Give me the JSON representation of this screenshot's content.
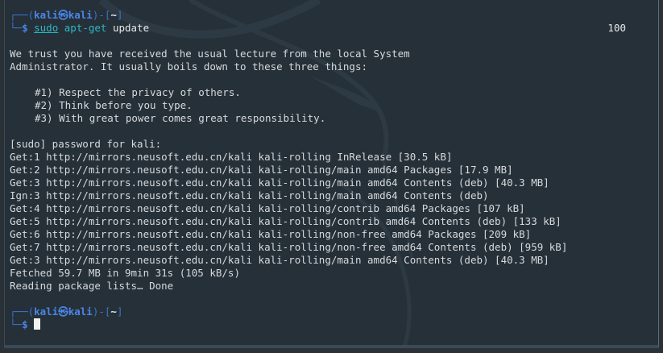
{
  "prompt": {
    "user": "kali",
    "at_icon": "kali-skull-icon",
    "host": "kali",
    "dir": "~",
    "top_left": "┌──(",
    "mid": ")-[",
    "top_right": "]",
    "bottom_left": "└─",
    "dollar": "$"
  },
  "command": {
    "sudo": "sudo",
    "aptget": "apt-get",
    "arg": "update",
    "exit_status": "100",
    "exit_icon": "✗"
  },
  "lecture": {
    "line1": "We trust you have received the usual lecture from the local System",
    "line2": "Administrator. It usually boils down to these three things:",
    "rule1": "#1) Respect the privacy of others.",
    "rule2": "#2) Think before you type.",
    "rule3": "#3) With great power comes great responsibility."
  },
  "password_prompt": "[sudo] password for kali:",
  "output_lines": [
    "Get:1 http://mirrors.neusoft.edu.cn/kali kali-rolling InRelease [30.5 kB]",
    "Get:2 http://mirrors.neusoft.edu.cn/kali kali-rolling/main amd64 Packages [17.9 MB]",
    "Get:3 http://mirrors.neusoft.edu.cn/kali kali-rolling/main amd64 Contents (deb) [40.3 MB]",
    "Ign:3 http://mirrors.neusoft.edu.cn/kali kali-rolling/main amd64 Contents (deb)",
    "Get:4 http://mirrors.neusoft.edu.cn/kali kali-rolling/contrib amd64 Packages [107 kB]",
    "Get:5 http://mirrors.neusoft.edu.cn/kali kali-rolling/contrib amd64 Contents (deb) [133 kB]",
    "Get:6 http://mirrors.neusoft.edu.cn/kali kali-rolling/non-free amd64 Packages [209 kB]",
    "Get:7 http://mirrors.neusoft.edu.cn/kali kali-rolling/non-free amd64 Contents (deb) [959 kB]",
    "Get:3 http://mirrors.neusoft.edu.cn/kali kali-rolling/main amd64 Contents (deb) [40.3 MB]",
    "Fetched 59.7 MB in 9min 31s (105 kB/s)",
    "Reading package lists… Done"
  ],
  "colors": {
    "background": "#263038",
    "prompt_blue": "#4a86e8",
    "command_cyan": "#2fb7c7",
    "error_red": "#e0443a",
    "text": "#d6dadd"
  }
}
